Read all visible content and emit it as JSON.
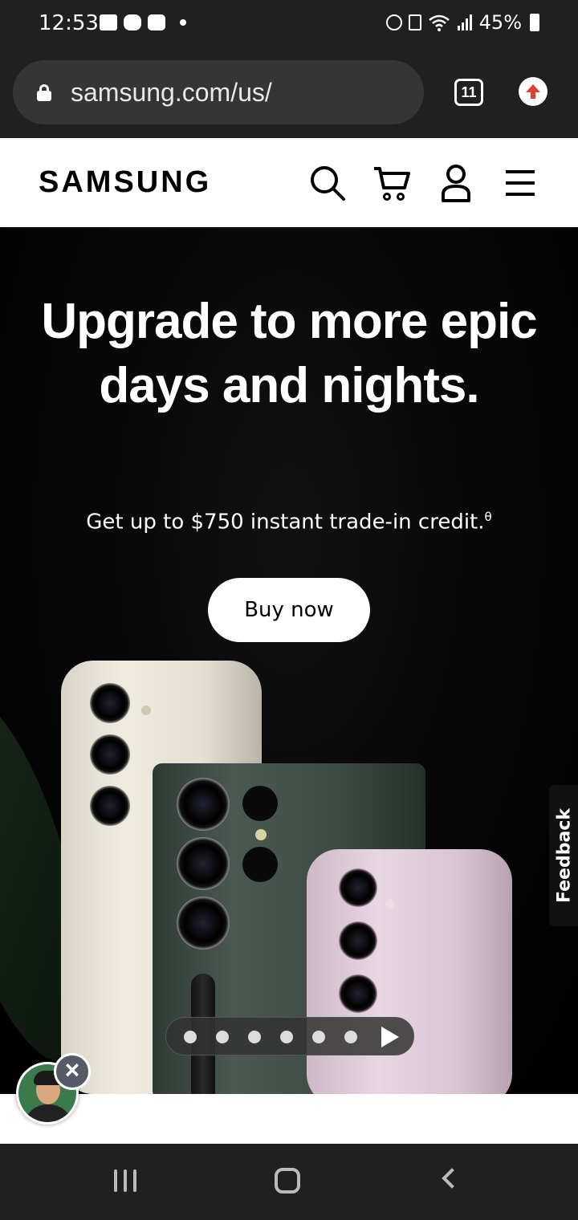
{
  "status_bar": {
    "time": "12:53",
    "battery": "45%"
  },
  "browser": {
    "url": "samsung.com/us/",
    "tab_count": "11"
  },
  "header": {
    "logo": "SAMSUNG"
  },
  "hero": {
    "title": "Upgrade to more epic days and nights.",
    "subtitle": "Get up to $750 instant trade-in credit.",
    "subtitle_sup": "θ",
    "cta_label": "Buy now",
    "carousel": {
      "slide_count": 6,
      "current_slide": 1
    }
  },
  "feedback": {
    "label": "Feedback"
  },
  "colors": {
    "hero_bg": "#000000",
    "cta_bg": "#ffffff",
    "ext_icon_red": "#e04030"
  }
}
